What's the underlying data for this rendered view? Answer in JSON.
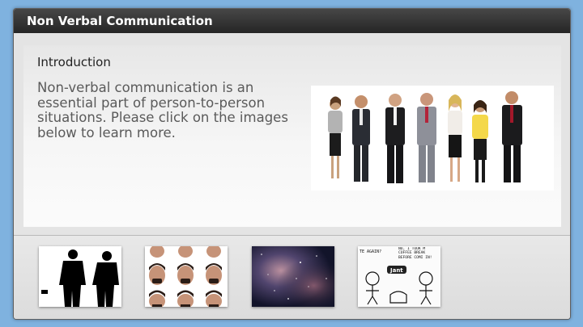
{
  "window": {
    "title": "Non Verbal Communication"
  },
  "intro": {
    "heading": "Introduction",
    "text": "Non-verbal communication is an essential part of person-to-person situations. Please click on the images below to learn more."
  },
  "hero_image": {
    "icon": "business-team-image"
  },
  "thumbnails": [
    {
      "icon": "silhouettes-image",
      "label": ""
    },
    {
      "icon": "facial-expressions-image",
      "label": ""
    },
    {
      "icon": "nebula-image",
      "label": ""
    },
    {
      "icon": "cartoon-image",
      "label": ""
    }
  ],
  "cartoon": {
    "bubble_left": "TE AGAIN?",
    "bubble_right": "NO, I TOOK M COFFEE BREAK BEFORE COMI IN!",
    "caption": "Jant"
  }
}
